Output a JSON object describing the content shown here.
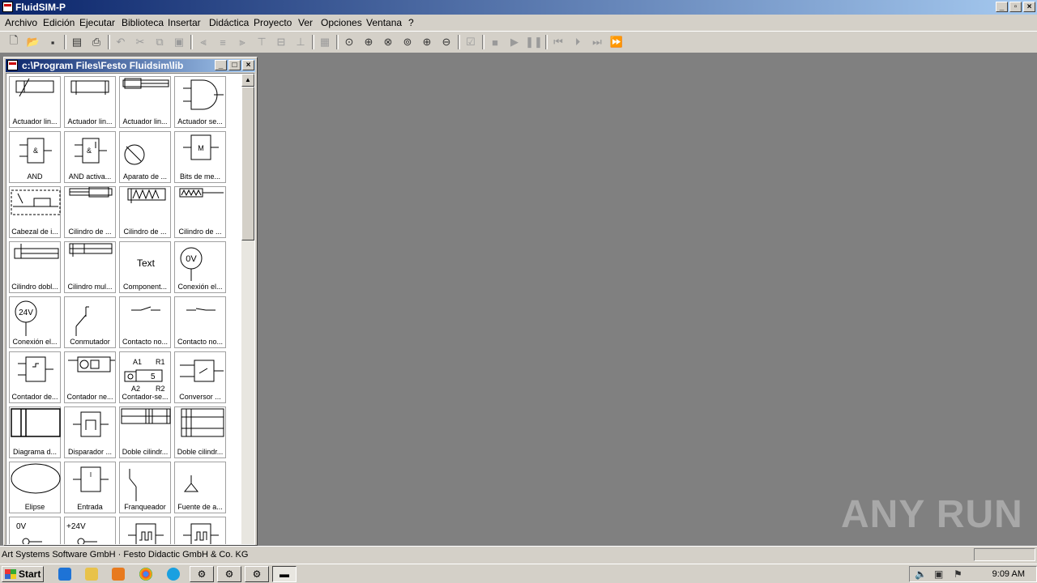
{
  "window": {
    "title": "FluidSIM-P",
    "controls": [
      "minimize",
      "restore",
      "close"
    ]
  },
  "menu": [
    "Archivo",
    "Edición",
    "Ejecutar",
    "Biblioteca",
    "Insertar",
    "Didáctica",
    "Proyecto",
    "Ver",
    "Opciones",
    "Ventana",
    "?"
  ],
  "toolbar": {
    "icons": [
      "new-file-icon",
      "open-folder-icon",
      "save-icon",
      "preview-icon",
      "print-icon",
      "undo-icon",
      "cut-icon",
      "copy-icon",
      "paste-icon",
      "align-left-icon",
      "align-center-icon",
      "align-right-icon",
      "align-top-icon",
      "align-middle-icon",
      "align-bottom-icon",
      "grid-icon",
      "zoom-100-icon",
      "zoom-window-icon",
      "zoom-fit-icon",
      "zoom-prev-icon",
      "zoom-in-icon",
      "zoom-out-icon",
      "check-icon",
      "stop-icon",
      "play-icon",
      "pause-icon",
      "reset-icon",
      "step-icon",
      "step-forward-icon",
      "fast-forward-icon"
    ]
  },
  "library": {
    "title": "c:\\Program Files\\Festo Fluidsim\\lib",
    "items": [
      "Actuador lin...",
      "Actuador lin...",
      "Actuador lin...",
      "Actuador se...",
      "AND",
      "AND activa...",
      "Aparato de ...",
      "Bits de me...",
      "Cabezal de i...",
      "Cilindro de ...",
      "Cilindro de ...",
      "Cilindro de ...",
      "Cilindro dobl...",
      "Cilindro mul...",
      "Component...",
      "Conexión el...",
      "Conexión el...",
      "Conmutador",
      "Contacto no...",
      "Contacto no...",
      "Contador de...",
      "Contador ne...",
      "Contador-se...",
      "Conversor ...",
      "Diagrama d...",
      "Disparador ...",
      "Doble cilindr...",
      "Doble cilindr...",
      "Elipse",
      "Entrada",
      "Franqueador",
      "Fuente de a...",
      "",
      "",
      "",
      ""
    ],
    "symbol_texts": {
      "and": "&",
      "motor": "M",
      "text": "Text",
      "zero_volt": "0V",
      "plus_24v": "+24V",
      "v24": "24V",
      "counter": "5",
      "a1": "A1",
      "r1": "R1",
      "a2": "A2",
      "r2": "R2",
      "entrada": "I"
    }
  },
  "statusbar": {
    "text": "Art Systems Software GmbH · Festo Didactic GmbH & Co. KG"
  },
  "watermark": "ANY RUN",
  "taskbar": {
    "start": "Start",
    "clock": "9:09 AM"
  }
}
